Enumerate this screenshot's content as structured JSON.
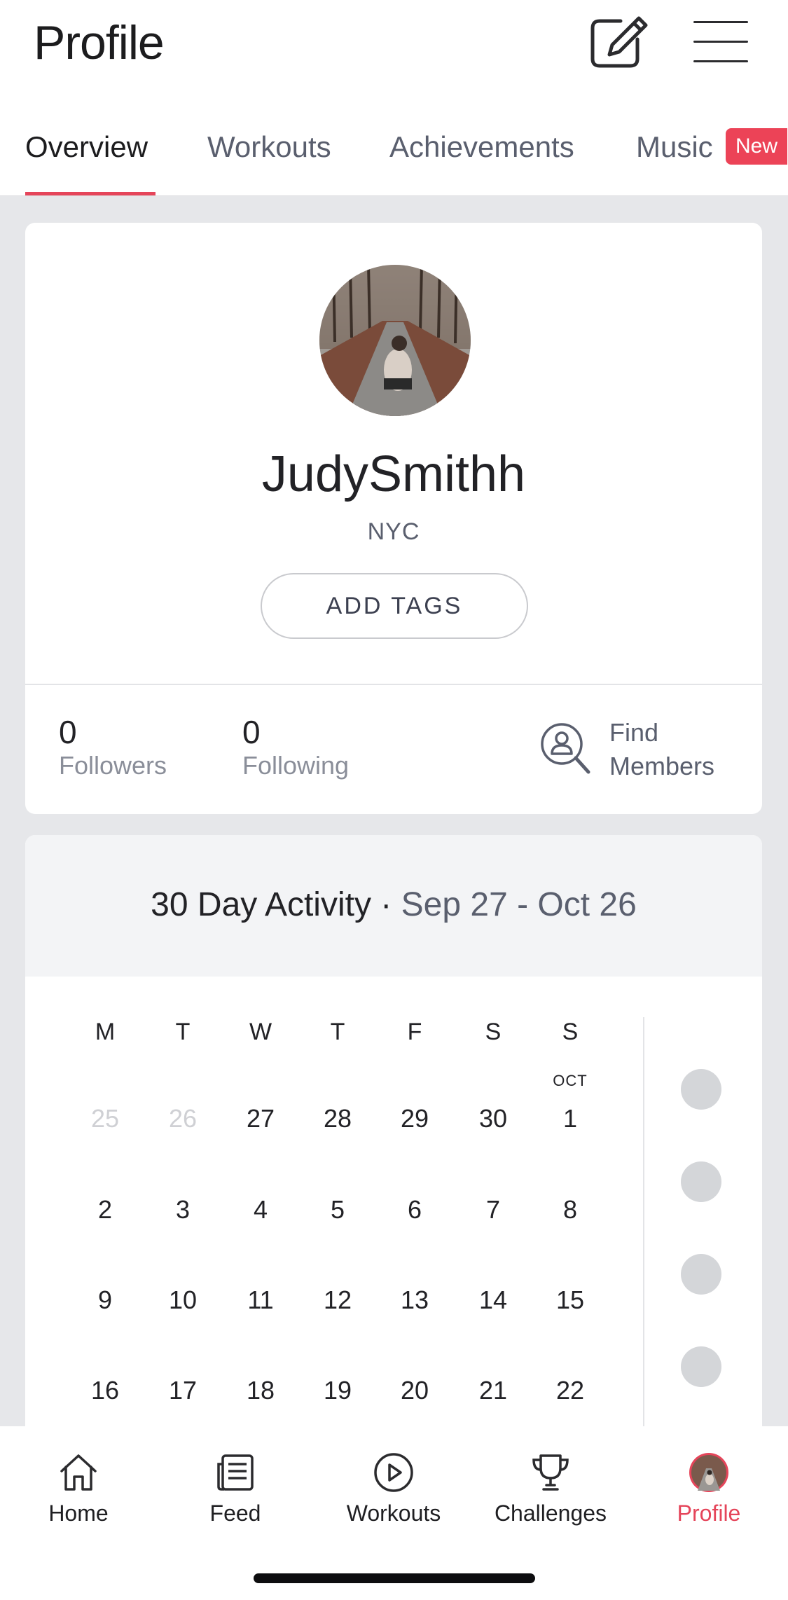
{
  "header": {
    "title": "Profile",
    "edit_icon": "edit-icon",
    "menu_icon": "hamburger-menu-icon"
  },
  "tabs": [
    {
      "label": "Overview",
      "active": true
    },
    {
      "label": "Workouts",
      "active": false
    },
    {
      "label": "Achievements",
      "active": false
    },
    {
      "label": "Music",
      "active": false,
      "badge": "New"
    }
  ],
  "profile": {
    "username": "JudySmithh",
    "location": "NYC",
    "add_tags_label": "ADD TAGS",
    "avatar_icon": "avatar-photo"
  },
  "stats": {
    "followers_count": "0",
    "followers_label": "Followers",
    "following_count": "0",
    "following_label": "Following",
    "find_members_line1": "Find",
    "find_members_line2": "Members"
  },
  "activity": {
    "title": "30 Day Activity · ",
    "range": "Sep 27 - Oct 26",
    "weekdays": [
      "M",
      "T",
      "W",
      "T",
      "F",
      "S",
      "S"
    ],
    "month_marker": "OCT",
    "weeks": [
      [
        "25",
        "26",
        "27",
        "28",
        "29",
        "30",
        "1"
      ],
      [
        "2",
        "3",
        "4",
        "5",
        "6",
        "7",
        "8"
      ],
      [
        "9",
        "10",
        "11",
        "12",
        "13",
        "14",
        "15"
      ],
      [
        "16",
        "17",
        "18",
        "19",
        "20",
        "21",
        "22"
      ]
    ],
    "muted_days": [
      "25",
      "26"
    ]
  },
  "bottom_nav": [
    {
      "label": "Home",
      "icon": "home-icon",
      "active": false
    },
    {
      "label": "Feed",
      "icon": "feed-icon",
      "active": false
    },
    {
      "label": "Workouts",
      "icon": "play-circle-icon",
      "active": false
    },
    {
      "label": "Challenges",
      "icon": "trophy-icon",
      "active": false
    },
    {
      "label": "Profile",
      "icon": "profile-avatar-icon",
      "active": true
    }
  ],
  "colors": {
    "accent": "#e5455a",
    "badge": "#ec4357",
    "background": "#e6e7ea",
    "muted_text": "#5a5f6e"
  }
}
